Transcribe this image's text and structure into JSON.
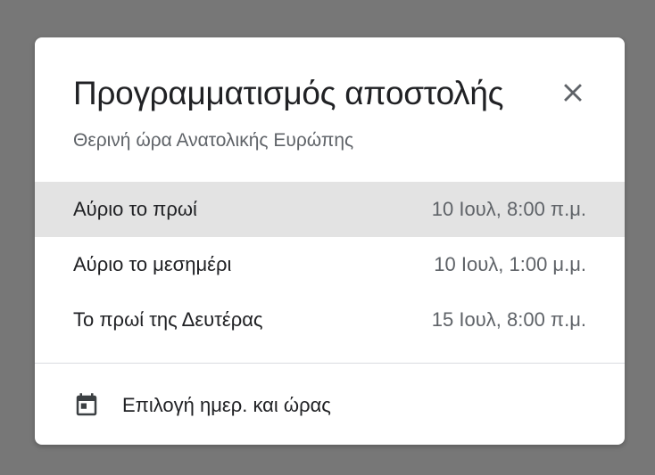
{
  "dialog": {
    "title": "Προγραμματισμός αποστολής",
    "subtitle": "Θερινή ώρα Ανατολικής Ευρώπης",
    "close_icon": "close-icon"
  },
  "options": [
    {
      "label": "Αύριο το πρωί",
      "time": "10 Ιουλ, 8:00 π.μ.",
      "selected": true
    },
    {
      "label": "Αύριο το μεσημέρι",
      "time": "10 Ιουλ, 1:00 μ.μ.",
      "selected": false
    },
    {
      "label": "Το πρωί της Δευτέρας",
      "time": "15 Ιουλ, 8:00 π.μ.",
      "selected": false
    }
  ],
  "pick_custom": {
    "icon": "calendar-icon",
    "label": "Επιλογή ημερ. και ώρας"
  },
  "colors": {
    "backdrop": "#777777",
    "dialog_bg": "#ffffff",
    "selected_row_bg": "#e3e3e3",
    "primary_text": "#202124",
    "secondary_text": "#5f6368"
  }
}
